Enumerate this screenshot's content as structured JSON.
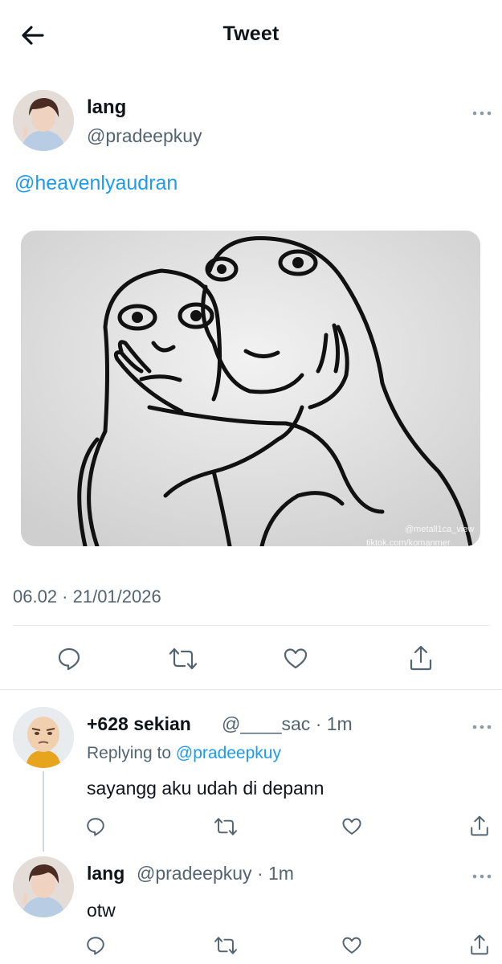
{
  "header": {
    "title": "Tweet",
    "back_icon": "arrow-left-icon"
  },
  "tweet": {
    "author_name": "lang",
    "author_handle": "@pradeepkuy",
    "text": "@heavenlyaudran",
    "media_watermark_1": "@metall1ca_view",
    "media_watermark_2": "tiktok.com/komanmer",
    "timestamp": "06.02 · 21/01/2026",
    "actions": [
      "reply-icon",
      "retweet-icon",
      "like-icon",
      "share-icon"
    ]
  },
  "replies": [
    {
      "name": "+628 sekian",
      "handle": "@____sac",
      "time": "· 1m",
      "replying_prefix": "Replying to ",
      "replying_to": "@pradeepkuy",
      "text": "sayangg aku udah di depann"
    },
    {
      "name": "lang",
      "handle": "@pradeepkuy",
      "time": "· 1m",
      "text": "otw"
    }
  ],
  "colors": {
    "accent": "#1d9bf0",
    "secondary_text": "#536471",
    "primary_text": "#0f1419",
    "divider": "#e6e9ec"
  }
}
